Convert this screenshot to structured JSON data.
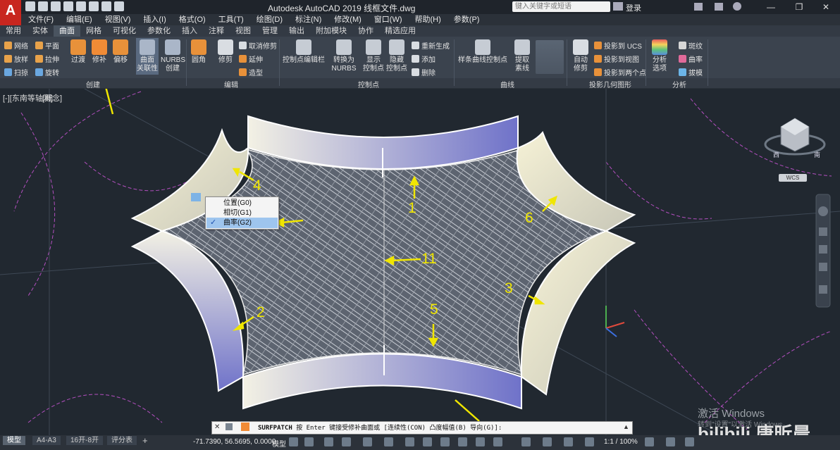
{
  "app": {
    "title": "Autodesk AutoCAD 2019    线框文件.dwg",
    "logo_letter": "A",
    "search_placeholder": "键入关键字或短语",
    "login_label": "登录"
  },
  "menubar": [
    "文件(F)",
    "编辑(E)",
    "视图(V)",
    "插入(I)",
    "格式(O)",
    "工具(T)",
    "绘图(D)",
    "标注(N)",
    "修改(M)",
    "窗口(W)",
    "帮助(H)",
    "参数(P)"
  ],
  "ribbon_tabs": [
    "常用",
    "实体",
    "曲面",
    "网格",
    "可视化",
    "参数化",
    "插入",
    "注释",
    "视图",
    "管理",
    "输出",
    "附加模块",
    "协作",
    "精选应用"
  ],
  "ribbon_active_tab": "曲面",
  "ribbon": {
    "create_small": [
      "网络",
      "平面",
      "放样",
      "拉伸",
      "扫掠",
      "旋转"
    ],
    "create_large": [
      "过渡",
      "修补",
      "偏移"
    ],
    "surface_assoc": [
      "曲面\n关联性",
      "NURBS\n创建"
    ],
    "fillet": "圆角",
    "trim": "修剪",
    "edit_small": [
      "取消修剪",
      "延伸",
      "造型"
    ],
    "cp_editbar": "控制点编辑栏",
    "convert_nurbs": "转换为\nNURBS",
    "show_cp": "显示\n控制点",
    "hide_cp": "隐藏\n控制点",
    "cp_small": [
      "重新生成",
      "添加",
      "删除"
    ],
    "spline_cp": "样条曲线控制点",
    "extract_iso": "提取\n素线",
    "auto_trim": "自动\n修剪",
    "project_small": [
      "投影到 UCS",
      "投影到视图",
      "投影到两个点"
    ],
    "analysis_opts": "分析\n选项",
    "analysis_small": [
      "斑纹",
      "曲率",
      "拔模"
    ]
  },
  "panel_names": {
    "create": "创建",
    "edit": "编辑",
    "control_points": "控制点",
    "curves": "曲线",
    "projection": "投影几何图形",
    "analysis": "分析"
  },
  "viewport": {
    "label_left": "[-][东南等轴测]",
    "label_style": "[概念]",
    "viewcube_button": "WCS",
    "compass": {
      "west": "西",
      "south": "南"
    }
  },
  "context_menu": {
    "items": [
      {
        "label": "位置(G0)",
        "checked": false
      },
      {
        "label": "相切(G1)",
        "checked": false
      },
      {
        "label": "曲率(G2)",
        "checked": true
      }
    ]
  },
  "annotations": [
    "1",
    "2",
    "3",
    "4",
    "5",
    "6",
    "11"
  ],
  "command_line": {
    "command": "SURFPATCH",
    "prompt": "按 Enter 键接受修补曲面或 [连续性(CON) 凸度幅值(B) 导向(G)]:"
  },
  "status": {
    "layout_tabs": [
      "模型",
      "A4-A3",
      "16开-8开",
      "评分表"
    ],
    "coords": "-71.7390, 56.5695, 0.0000",
    "model_button": "模型",
    "scale": "1:1 / 100%"
  },
  "watermark": {
    "line1": "激活 Windows",
    "line2": "转到\"设置\"以激活 Windows。",
    "brand": "bilibili 唐昕晨"
  },
  "colors": {
    "accent_red": "#c8261f",
    "annotation_yellow": "#f0e600",
    "viewport_bg": "#212830",
    "ribbon_bg": "#3b434e",
    "surface_blue": "#6f72c9",
    "surface_cream": "#f0eed8",
    "guide_magenta": "#b44fc0"
  }
}
